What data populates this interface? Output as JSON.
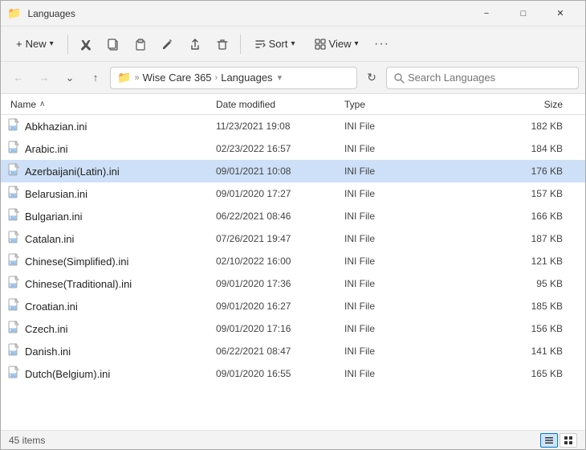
{
  "titlebar": {
    "title": "Languages",
    "icon": "📁"
  },
  "toolbar": {
    "new_label": "New",
    "new_chevron": "▾",
    "cut_icon": "✂",
    "copy_icon": "⧉",
    "paste_icon": "📋",
    "rename_icon": "✏",
    "share_icon": "↑",
    "delete_icon": "🗑",
    "sort_label": "Sort",
    "sort_chevron": "▾",
    "view_label": "View",
    "view_chevron": "▾",
    "more_icon": "···"
  },
  "addressbar": {
    "back_disabled": true,
    "forward_disabled": true,
    "up_label": "↑",
    "path_icon": "📁",
    "path_parent": "Wise Care 365",
    "path_current": "Languages",
    "search_placeholder": "Search Languages"
  },
  "columns": {
    "name": "Name",
    "date": "Date modified",
    "type": "Type",
    "size": "Size",
    "sort_arrow": "∧"
  },
  "files": [
    {
      "name": "Abkhazian.ini",
      "date": "11/23/2021 19:08",
      "type": "INI File",
      "size": "182 KB",
      "selected": false
    },
    {
      "name": "Arabic.ini",
      "date": "02/23/2022 16:57",
      "type": "INI File",
      "size": "184 KB",
      "selected": false
    },
    {
      "name": "Azerbaijani(Latin).ini",
      "date": "09/01/2021 10:08",
      "type": "INI File",
      "size": "176 KB",
      "selected": true
    },
    {
      "name": "Belarusian.ini",
      "date": "09/01/2020 17:27",
      "type": "INI File",
      "size": "157 KB",
      "selected": false
    },
    {
      "name": "Bulgarian.ini",
      "date": "06/22/2021 08:46",
      "type": "INI File",
      "size": "166 KB",
      "selected": false
    },
    {
      "name": "Catalan.ini",
      "date": "07/26/2021 19:47",
      "type": "INI File",
      "size": "187 KB",
      "selected": false
    },
    {
      "name": "Chinese(Simplified).ini",
      "date": "02/10/2022 16:00",
      "type": "INI File",
      "size": "121 KB",
      "selected": false
    },
    {
      "name": "Chinese(Traditional).ini",
      "date": "09/01/2020 17:36",
      "type": "INI File",
      "size": "95 KB",
      "selected": false
    },
    {
      "name": "Croatian.ini",
      "date": "09/01/2020 16:27",
      "type": "INI File",
      "size": "185 KB",
      "selected": false
    },
    {
      "name": "Czech.ini",
      "date": "09/01/2020 17:16",
      "type": "INI File",
      "size": "156 KB",
      "selected": false
    },
    {
      "name": "Danish.ini",
      "date": "06/22/2021 08:47",
      "type": "INI File",
      "size": "141 KB",
      "selected": false
    },
    {
      "name": "Dutch(Belgium).ini",
      "date": "09/01/2020 16:55",
      "type": "INI File",
      "size": "165 KB",
      "selected": false
    }
  ],
  "statusbar": {
    "count": "45 items"
  }
}
